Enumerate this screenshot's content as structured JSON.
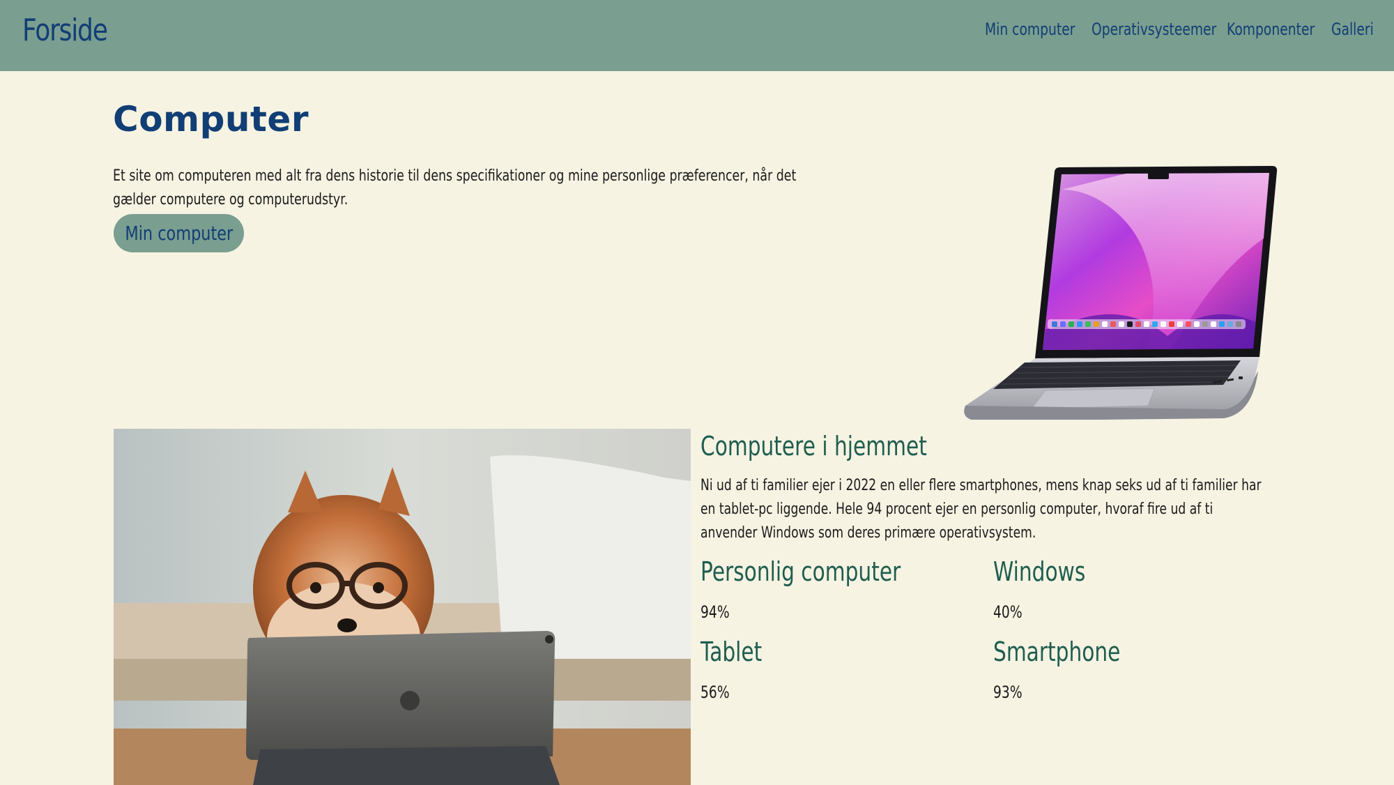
{
  "nav": {
    "brand": "Forside",
    "links": [
      {
        "label": "Min computer"
      },
      {
        "label": "Operativsysteemer"
      },
      {
        "label": "Komponenter"
      },
      {
        "label": "Galleri"
      }
    ]
  },
  "hero": {
    "title": "Computer",
    "intro": "Et site om computeren med alt fra dens historie til dens specifikationer og mine personlige præferencer, når det gælder computere og computerudstyr.",
    "button_label": "Min computer"
  },
  "stats_section": {
    "title": "Computere i hjemmet",
    "text": "Ni ud af ti familier ejer i 2022 en eller flere smartphones, mens knap seks ud af ti familier har en tablet-pc liggende. Hele 94 procent ejer en personlig computer, hvoraf fire ud af ti anvender Windows som deres primære operativsystem.",
    "items": [
      {
        "label": "Personlig computer",
        "value": "94%"
      },
      {
        "label": "Windows",
        "value": "40%"
      },
      {
        "label": "Tablet",
        "value": "56%"
      },
      {
        "label": "Smartphone",
        "value": "93%"
      }
    ]
  },
  "colors": {
    "navbar": "#7a9e90",
    "background": "#f6f3e3",
    "primary_text": "#113e74",
    "accent_heading": "#1f5d4f"
  },
  "icons": {
    "laptop_image": "laptop-image",
    "dog_photo": "dog-with-glasses-photo"
  }
}
